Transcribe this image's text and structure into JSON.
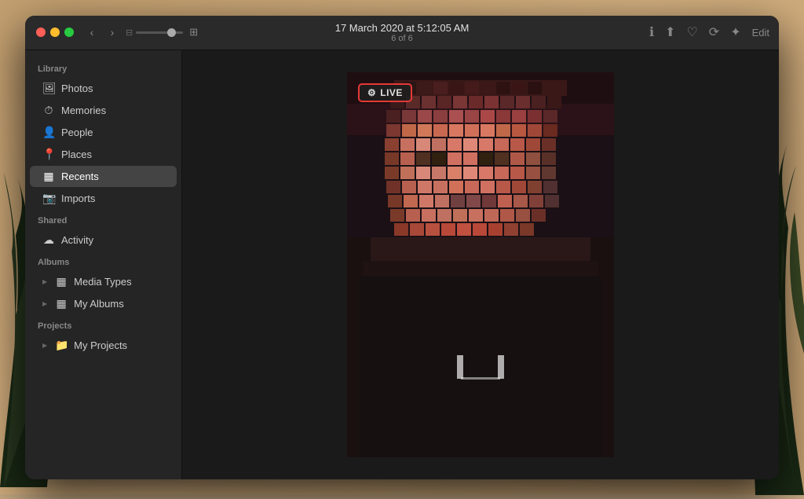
{
  "window": {
    "title": "17 March 2020 at 5:12:05 AM",
    "subtitle": "6 of 6"
  },
  "titlebar": {
    "back_label": "‹",
    "forward_label": "›",
    "edit_label": "Edit",
    "info_icon": "ℹ",
    "share_icon": "⬆",
    "heart_icon": "♡",
    "lock_icon": "⊕",
    "adjust_icon": "✦"
  },
  "sidebar": {
    "sections": [
      {
        "label": "Library",
        "items": [
          {
            "id": "photos",
            "label": "Photos",
            "icon": "🖼"
          },
          {
            "id": "memories",
            "label": "Memories",
            "icon": "⏱"
          },
          {
            "id": "people",
            "label": "People",
            "icon": "👤"
          },
          {
            "id": "places",
            "label": "Places",
            "icon": "📍"
          },
          {
            "id": "recents",
            "label": "Recents",
            "icon": "▦",
            "active": true
          },
          {
            "id": "imports",
            "label": "Imports",
            "icon": "📷"
          }
        ]
      },
      {
        "label": "Shared",
        "items": [
          {
            "id": "activity",
            "label": "Activity",
            "icon": "☁"
          }
        ]
      },
      {
        "label": "Albums",
        "items": [
          {
            "id": "media-types",
            "label": "Media Types",
            "icon": "▦",
            "expandable": true
          },
          {
            "id": "my-albums",
            "label": "My Albums",
            "icon": "▦",
            "expandable": true
          }
        ]
      },
      {
        "label": "Projects",
        "items": [
          {
            "id": "my-projects",
            "label": "My Projects",
            "icon": "📁",
            "expandable": true
          }
        ]
      }
    ]
  },
  "photo": {
    "live_badge": "LIVE",
    "live_icon": "⚙"
  },
  "colors": {
    "accent": "#e53935",
    "sidebar_bg": "#252525",
    "window_bg": "#1e1e1e",
    "active_item": "#444444",
    "text_primary": "#e0e0e0",
    "text_secondary": "#888888"
  }
}
